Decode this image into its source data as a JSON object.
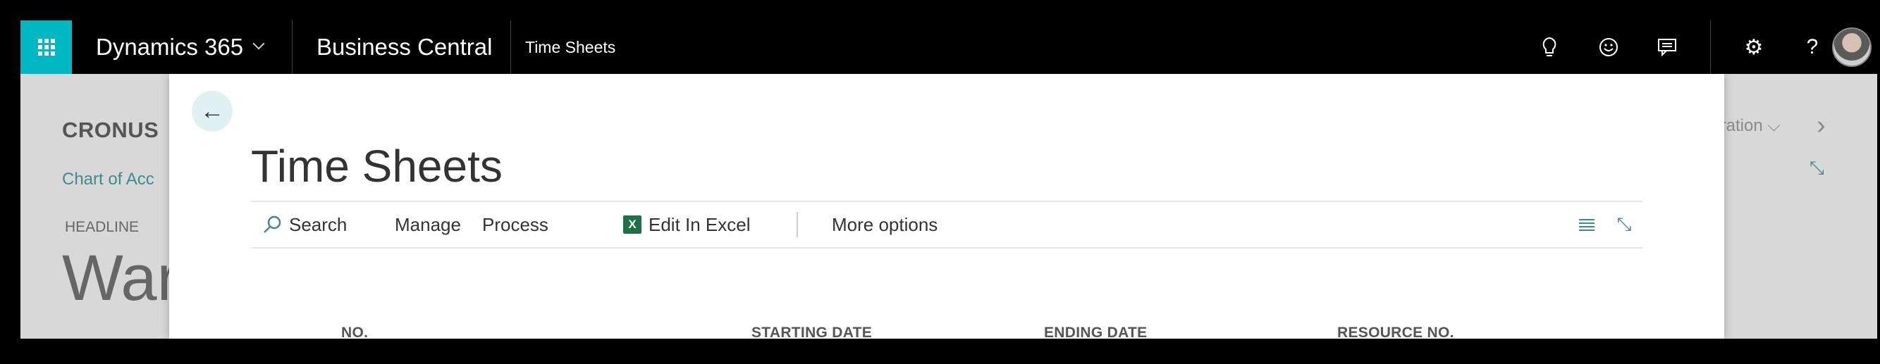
{
  "topbar": {
    "product": "Dynamics 365",
    "app": "Business Central",
    "crumb": "Time Sheets"
  },
  "background_page": {
    "company": "CRONUS",
    "link": "Chart of Acc",
    "headline_label": "HEADLINE",
    "headline_text": "War",
    "role_center": "trati on"
  },
  "dialog": {
    "title": "Time Sheets",
    "actions": {
      "search": "Search",
      "manage": "Manage",
      "process": "Process",
      "edit_in_excel": "Edit In Excel",
      "more_options": "More options"
    },
    "columns": [
      "NO.",
      "STARTING DATE",
      "ENDING DATE",
      "RESOURCE NO."
    ]
  },
  "colors": {
    "waffle": "#00b7c3",
    "accent": "#3f8a8e",
    "topbar": "#000000"
  },
  "icons": [
    "waffle-icon",
    "lightbulb-icon",
    "smiley-icon",
    "feedback-icon",
    "gear-icon",
    "help-icon",
    "back-arrow-icon",
    "search-icon",
    "excel-icon",
    "list-view-icon",
    "collapse-icon",
    "chevron-right-icon"
  ]
}
